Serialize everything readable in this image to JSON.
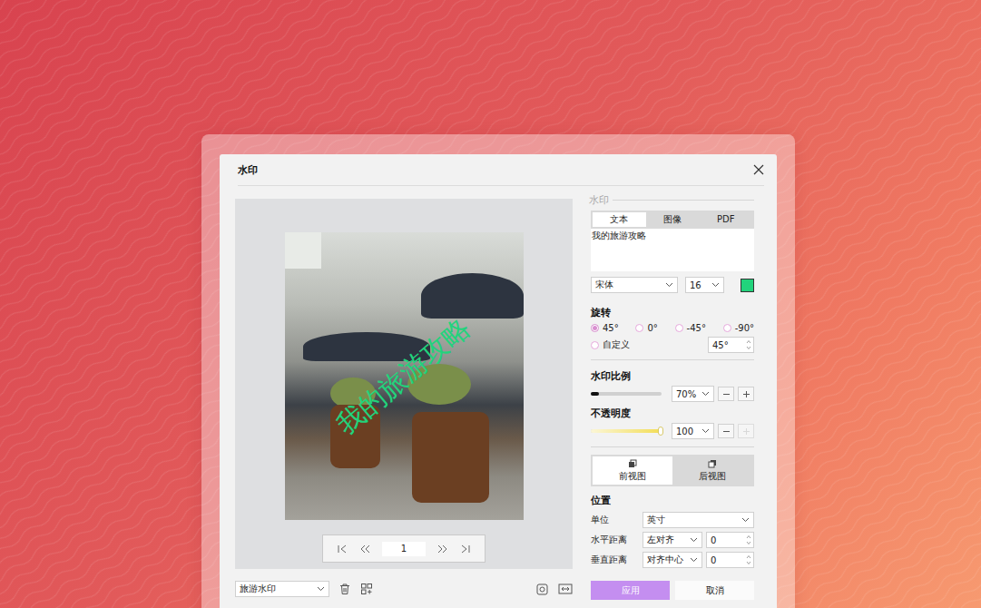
{
  "dialog": {
    "title": "水印"
  },
  "preview": {
    "watermark": "我的旅游攻略",
    "page": "1"
  },
  "preset": "旅游水印",
  "panel": {
    "section": "水印",
    "tabs": [
      {
        "label": "文本",
        "selected": true
      },
      {
        "label": "图像",
        "selected": false
      },
      {
        "label": "PDF",
        "selected": false
      }
    ],
    "text": "我的旅游攻略",
    "font": "宋体",
    "size": "16",
    "color": "#22d37c",
    "rotation": {
      "label": "旋转",
      "options": [
        {
          "label": "45°",
          "selected": true
        },
        {
          "label": "0°",
          "selected": false
        },
        {
          "label": "-45°",
          "selected": false
        },
        {
          "label": "-90°",
          "selected": false
        },
        {
          "label": "自定义",
          "selected": false
        }
      ],
      "custom": "45°"
    },
    "scale": {
      "label": "水印比例",
      "level": 0.12,
      "value": "70%",
      "plus_disabled": false
    },
    "opacity": {
      "label": "不透明度",
      "level": 1,
      "value": "100",
      "plus_disabled": true
    },
    "views": [
      {
        "label": "前视图",
        "selected": true
      },
      {
        "label": "后视图",
        "selected": false
      }
    ],
    "position": {
      "label": "位置",
      "rows": [
        {
          "kind": "select",
          "label": "单位",
          "value": "英寸"
        },
        {
          "kind": "select-number",
          "label": "水平距离",
          "value": "左对齐",
          "number": "0"
        },
        {
          "kind": "select-number",
          "label": "垂直距离",
          "value": "对齐中心",
          "number": "0"
        }
      ]
    }
  },
  "buttons": [
    {
      "label": "应用",
      "primary": true
    },
    {
      "label": "取消",
      "primary": false
    }
  ]
}
